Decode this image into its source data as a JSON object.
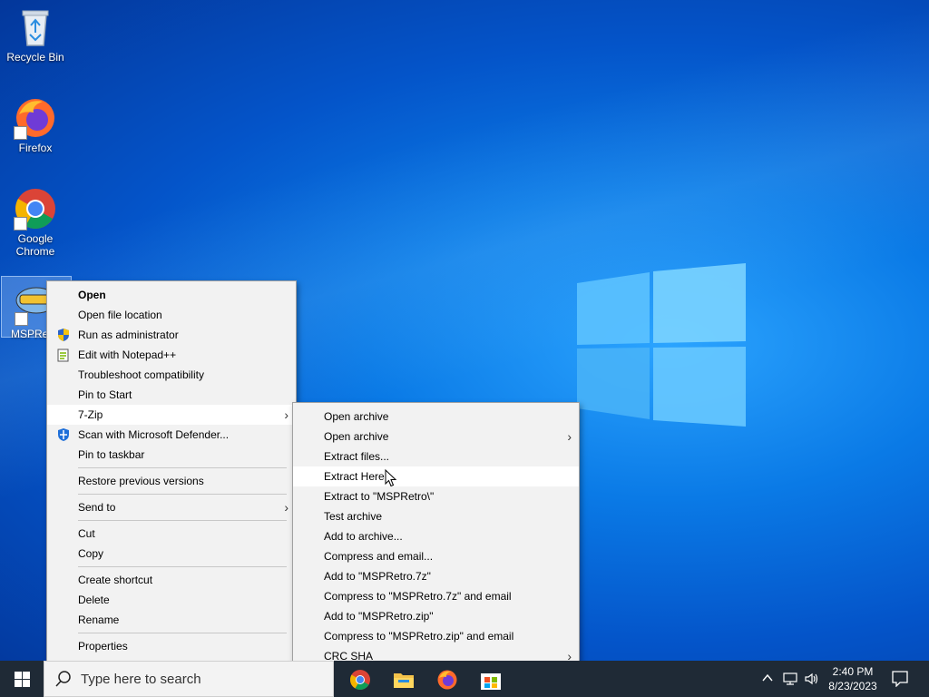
{
  "desktop": {
    "icons": [
      {
        "label": "Recycle Bin",
        "icon": "recycle-bin-icon"
      },
      {
        "label": "Firefox",
        "icon": "firefox-icon"
      },
      {
        "label": "Google Chrome",
        "icon": "chrome-icon"
      },
      {
        "label": "MSPRe",
        "icon": "msp-retro-icon"
      }
    ]
  },
  "context_menu": {
    "items": [
      {
        "label": "Open"
      },
      {
        "label": "Open file location"
      },
      {
        "label": "Run as administrator",
        "icon": "shield-icon"
      },
      {
        "label": "Edit with Notepad++",
        "icon": "notepad-plus-plus-icon"
      },
      {
        "label": "Troubleshoot compatibility"
      },
      {
        "label": "Pin to Start"
      },
      {
        "label": "7-Zip"
      },
      {
        "label": "Scan with Microsoft Defender...",
        "icon": "defender-icon"
      },
      {
        "label": "Pin to taskbar"
      },
      {
        "label": "Restore previous versions"
      },
      {
        "label": "Send to"
      },
      {
        "label": "Cut"
      },
      {
        "label": "Copy"
      },
      {
        "label": "Create shortcut"
      },
      {
        "label": "Delete"
      },
      {
        "label": "Rename"
      },
      {
        "label": "Properties"
      }
    ]
  },
  "submenu_7zip": {
    "items": [
      {
        "label": "Open archive"
      },
      {
        "label": "Open archive"
      },
      {
        "label": "Extract files..."
      },
      {
        "label": "Extract Here"
      },
      {
        "label": "Extract to \"MSPRetro\\\""
      },
      {
        "label": "Test archive"
      },
      {
        "label": "Add to archive..."
      },
      {
        "label": "Compress and email..."
      },
      {
        "label": "Add to \"MSPRetro.7z\""
      },
      {
        "label": "Compress to \"MSPRetro.7z\" and email"
      },
      {
        "label": "Add to \"MSPRetro.zip\""
      },
      {
        "label": "Compress to \"MSPRetro.zip\" and email"
      },
      {
        "label": "CRC SHA"
      }
    ]
  },
  "taskbar": {
    "search_placeholder": "Type here to search",
    "apps": [
      "chrome-icon",
      "file-explorer-icon",
      "firefox-icon",
      "microsoft-store-icon"
    ],
    "tray_icons": [
      "chevron-up-icon",
      "network-icon",
      "volume-icon"
    ],
    "time": "2:40 PM",
    "date": "8/23/2023",
    "notification_icon": "notification-icon"
  },
  "colors": {
    "taskbar": "#1f2a36",
    "menu_bg": "#f2f2f2",
    "accent": "#0a7ae6"
  }
}
